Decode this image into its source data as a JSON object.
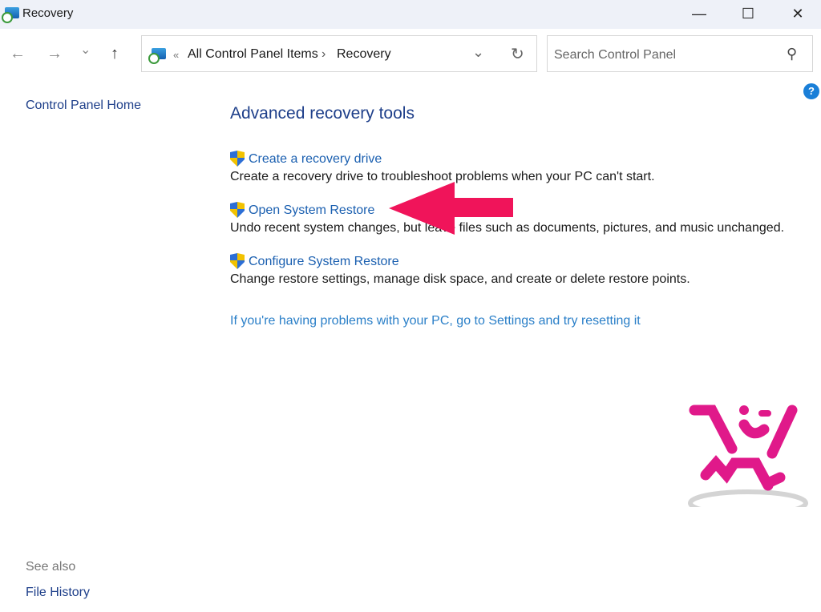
{
  "window": {
    "title": "Recovery",
    "minimize": "—",
    "maximize": "☐",
    "close": "✕"
  },
  "nav": {
    "back": "←",
    "forward": "→",
    "recent": "⌄",
    "up": "↑"
  },
  "address": {
    "overflow": "«",
    "crumbs": [
      "All Control Panel Items",
      "Recovery"
    ],
    "sep": "›",
    "dropdown": "⌄",
    "refresh": "↻"
  },
  "search": {
    "placeholder": "Search Control Panel",
    "icon": "⚲"
  },
  "help": "?",
  "sidebar": {
    "home": "Control Panel Home",
    "see_also": "See also",
    "file_history": "File History"
  },
  "main": {
    "heading": "Advanced recovery tools",
    "items": [
      {
        "label": "Create a recovery drive",
        "desc": "Create a recovery drive to troubleshoot problems when your PC can't start."
      },
      {
        "label": "Open System Restore",
        "desc": "Undo recent system changes, but leave files such as documents, pictures, and music unchanged."
      },
      {
        "label": "Configure System Restore",
        "desc": "Change restore settings, manage disk space, and create or delete restore points."
      }
    ],
    "reset_link": "If you're having problems with your PC, go to Settings and try resetting it"
  },
  "colors": {
    "arrow": "#f0145a",
    "logo": "#e0198a",
    "link": "#1a5fb0"
  }
}
